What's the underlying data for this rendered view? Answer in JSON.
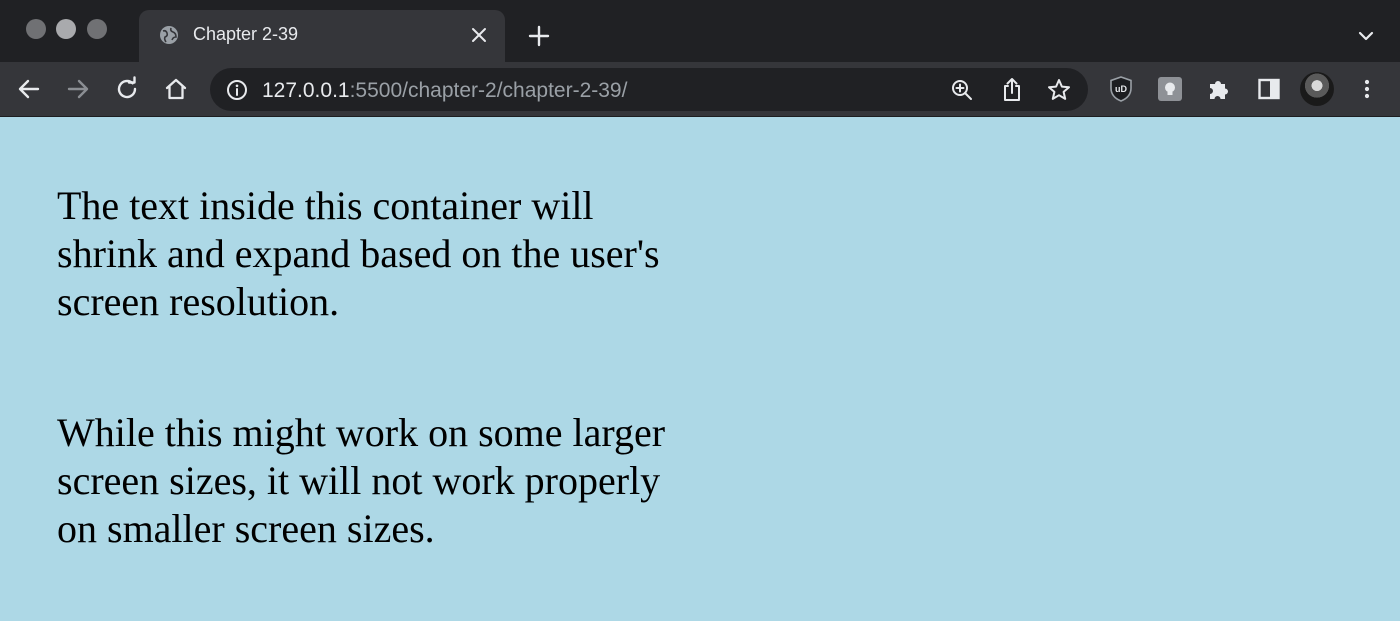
{
  "browser": {
    "tab": {
      "title": "Chapter 2-39"
    },
    "address_bar": {
      "host": "127.0.0.1",
      "path": ":5500/chapter-2/chapter-2-39/"
    },
    "icons": {
      "back": "back-arrow-icon",
      "forward": "forward-arrow-icon",
      "reload": "reload-icon",
      "home": "home-icon",
      "info": "info-icon",
      "zoom": "zoom-icon",
      "share": "share-icon",
      "bookmark": "star-icon",
      "ublock_label": "uD"
    }
  },
  "page": {
    "background_color": "#add8e6",
    "paragraphs": [
      "The text inside this container will shrink and expand based on the user's screen resolution.",
      "While this might work on some larger screen sizes, it will not work properly on smaller screen sizes."
    ]
  }
}
